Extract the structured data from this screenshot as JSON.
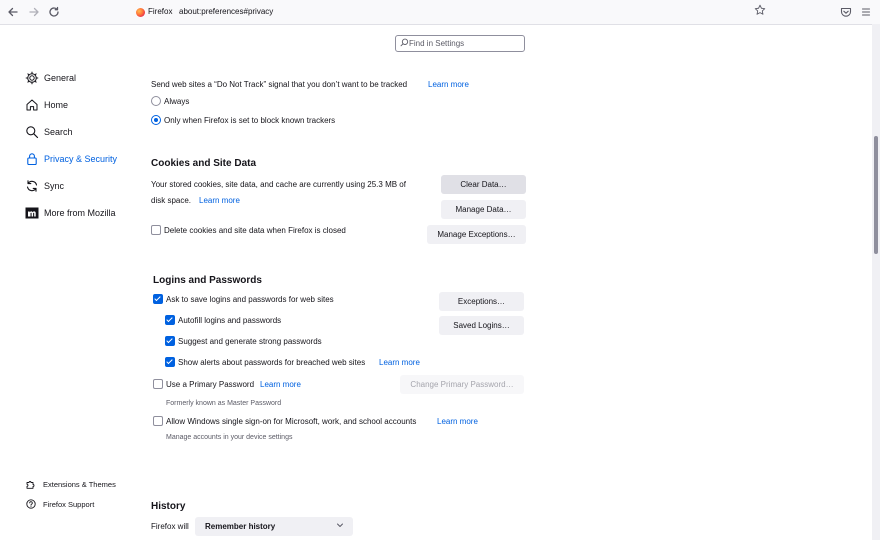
{
  "toolbar": {
    "back_icon": "arrow-left-icon",
    "forward_icon": "arrow-right-icon",
    "reload_icon": "reload-icon",
    "brand_label": "Firefox",
    "url": "about:preferences#privacy",
    "bookmark_icon": "star-icon",
    "pocket_icon": "pocket-icon",
    "menu_icon": "hamburger-menu-icon"
  },
  "search": {
    "placeholder": "Find in Settings"
  },
  "sidebar": {
    "items": [
      {
        "label": "General",
        "icon": "gear-icon"
      },
      {
        "label": "Home",
        "icon": "house-icon"
      },
      {
        "label": "Search",
        "icon": "search-icon"
      },
      {
        "label": "Privacy & Security",
        "icon": "lock-icon",
        "active": true
      },
      {
        "label": "Sync",
        "icon": "sync-icon"
      },
      {
        "label": "More from Mozilla",
        "icon": "mozilla-icon"
      }
    ],
    "footer": [
      {
        "label": "Extensions & Themes",
        "icon": "puzzle-icon"
      },
      {
        "label": "Firefox Support",
        "icon": "help-icon"
      }
    ]
  },
  "dnt": {
    "text": "Send web sites a “Do Not Track” signal that you don’t want to be tracked",
    "learn_more": "Learn more",
    "options": [
      {
        "label": "Always",
        "selected": false
      },
      {
        "label": "Only when Firefox is set to block known trackers",
        "selected": true
      }
    ]
  },
  "cookies": {
    "heading": "Cookies and Site Data",
    "desc_line1": "Your stored cookies, site data, and cache are currently using 25.3 MB of",
    "desc_line2": "disk space.",
    "learn_more": "Learn more",
    "clear_button": "Clear Data…",
    "manage_button": "Manage Data…",
    "delete_on_close_label": "Delete cookies and site data when Firefox is closed",
    "delete_on_close_checked": false,
    "exceptions_button": "Manage Exceptions…"
  },
  "logins": {
    "heading": "Logins and Passwords",
    "ask_to_save_label": "Ask to save logins and passwords for web sites",
    "autofill_label": "Autofill logins and passwords",
    "suggest_label": "Suggest and generate strong passwords",
    "breach_label": "Show alerts about passwords for breached web sites",
    "breach_learn_more": "Learn more",
    "exceptions_button": "Exceptions…",
    "saved_logins_button": "Saved Logins…",
    "primary_password_label": "Use a Primary Password",
    "primary_learn_more": "Learn more",
    "change_primary_button": "Change Primary Password…",
    "formerly_known": "Formerly known as Master Password",
    "sso_label": "Allow Windows single sign-on for Microsoft, work, and school accounts",
    "sso_learn_more": "Learn more",
    "sso_desc": "Manage accounts in your device settings"
  },
  "history": {
    "heading": "History",
    "firefox_will_label": "Firefox will",
    "selected_option": "Remember history"
  },
  "colors": {
    "accent": "#0061e0",
    "button_bg": "#f0f0f4",
    "text": "#15141a"
  }
}
